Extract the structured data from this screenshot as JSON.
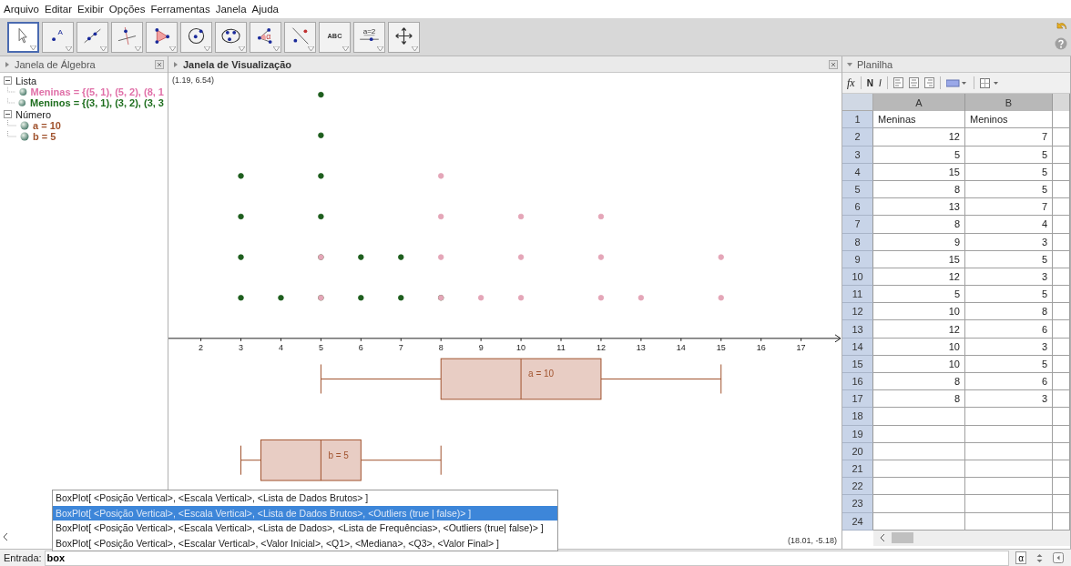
{
  "menu": [
    "Arquivo",
    "Editar",
    "Exibir",
    "Opções",
    "Ferramentas",
    "Janela",
    "Ajuda"
  ],
  "tools": [
    {
      "kind": "move",
      "selected": true
    },
    {
      "kind": "point",
      "selected": false,
      "label": "A"
    },
    {
      "kind": "line",
      "selected": false
    },
    {
      "kind": "perpendicular",
      "selected": false
    },
    {
      "kind": "polygon",
      "selected": false
    },
    {
      "kind": "circle",
      "selected": false
    },
    {
      "kind": "conic",
      "selected": false
    },
    {
      "kind": "angle",
      "selected": false,
      "label": "α"
    },
    {
      "kind": "reflect",
      "selected": false
    },
    {
      "kind": "text",
      "selected": false,
      "label": "ABC"
    },
    {
      "kind": "slider",
      "selected": false,
      "label": "a=2"
    },
    {
      "kind": "pan",
      "selected": false
    }
  ],
  "algebra": {
    "title": "Janela de Álgebra",
    "groups": [
      {
        "label": "Lista",
        "expanded": true,
        "items": [
          {
            "text": "Meninas = {(5, 1), (5, 2), (8, 1",
            "color": "#e070a8",
            "visible": true
          },
          {
            "text": "Meninos = {(3, 1), (3, 2), (3, 3",
            "color": "#1e6e1e",
            "visible": true
          }
        ]
      },
      {
        "label": "Número",
        "expanded": true,
        "items": [
          {
            "text": "a = 10",
            "color": "#a0522d",
            "visible": true
          },
          {
            "text": "b = 5",
            "color": "#a0522d",
            "visible": true
          }
        ]
      }
    ]
  },
  "graphics": {
    "title": "Janela de Visualização",
    "corner_top_left": "(1.19, 6.54)",
    "corner_bottom_right": "(18.01, -5.18)",
    "tick_labels": [
      "2",
      "3",
      "4",
      "5",
      "6",
      "7",
      "8",
      "9",
      "10",
      "11",
      "12",
      "13",
      "14",
      "15",
      "16",
      "17"
    ],
    "dot_series": [
      {
        "color": "#e4a6b8"
      },
      {
        "color": "#1e5e1e"
      }
    ],
    "box_labels": [
      "a = 10",
      "b = 5"
    ]
  },
  "spreadsheet": {
    "title": "Planilha",
    "format_buttons": [
      "N",
      "I"
    ],
    "function_label": "fx",
    "columns": [
      "A",
      "B"
    ],
    "rows": [
      {
        "n": "1",
        "a": "Meninas",
        "b": "Meninos",
        "kind": "text"
      },
      {
        "n": "2",
        "a": "12",
        "b": "7",
        "kind": "number"
      },
      {
        "n": "3",
        "a": "5",
        "b": "5",
        "kind": "number"
      },
      {
        "n": "4",
        "a": "15",
        "b": "5",
        "kind": "number"
      },
      {
        "n": "5",
        "a": "8",
        "b": "5",
        "kind": "number"
      },
      {
        "n": "6",
        "a": "13",
        "b": "7",
        "kind": "number"
      },
      {
        "n": "7",
        "a": "8",
        "b": "4",
        "kind": "number"
      },
      {
        "n": "8",
        "a": "9",
        "b": "3",
        "kind": "number"
      },
      {
        "n": "9",
        "a": "15",
        "b": "5",
        "kind": "number"
      },
      {
        "n": "10",
        "a": "12",
        "b": "3",
        "kind": "number"
      },
      {
        "n": "11",
        "a": "5",
        "b": "5",
        "kind": "number"
      },
      {
        "n": "12",
        "a": "10",
        "b": "8",
        "kind": "number"
      },
      {
        "n": "13",
        "a": "12",
        "b": "6",
        "kind": "number"
      },
      {
        "n": "14",
        "a": "10",
        "b": "3",
        "kind": "number"
      },
      {
        "n": "15",
        "a": "10",
        "b": "5",
        "kind": "number"
      },
      {
        "n": "16",
        "a": "8",
        "b": "6",
        "kind": "number"
      },
      {
        "n": "17",
        "a": "8",
        "b": "3",
        "kind": "number"
      },
      {
        "n": "18"
      },
      {
        "n": "19"
      },
      {
        "n": "20"
      },
      {
        "n": "21"
      },
      {
        "n": "22"
      },
      {
        "n": "23"
      },
      {
        "n": "24"
      }
    ]
  },
  "autocomplete": {
    "items": [
      {
        "text": "BoxPlot[ <Posição Vertical>, <Escala Vertical>, <Lista de Dados Brutos> ]",
        "selected": false
      },
      {
        "text": "BoxPlot[ <Posição Vertical>, <Escala Vertical>, <Lista de Dados Brutos>, <Outliers (true | false)> ]",
        "selected": true
      },
      {
        "text": "BoxPlot[ <Posição Vertical>, <Escala Vertical>, <Lista de Dados>, <Lista de Frequências>, <Outliers (true| false)> ]",
        "selected": false
      },
      {
        "text": "BoxPlot[ <Posição Vertical>, <Escalar Vertical>, <Valor Inicial>, <Q1>, <Mediana>, <Q3>, <Valor Final> ]",
        "selected": false
      }
    ]
  },
  "input_bar": {
    "label": "Entrada:",
    "value": "box",
    "alpha_button": "α"
  }
}
